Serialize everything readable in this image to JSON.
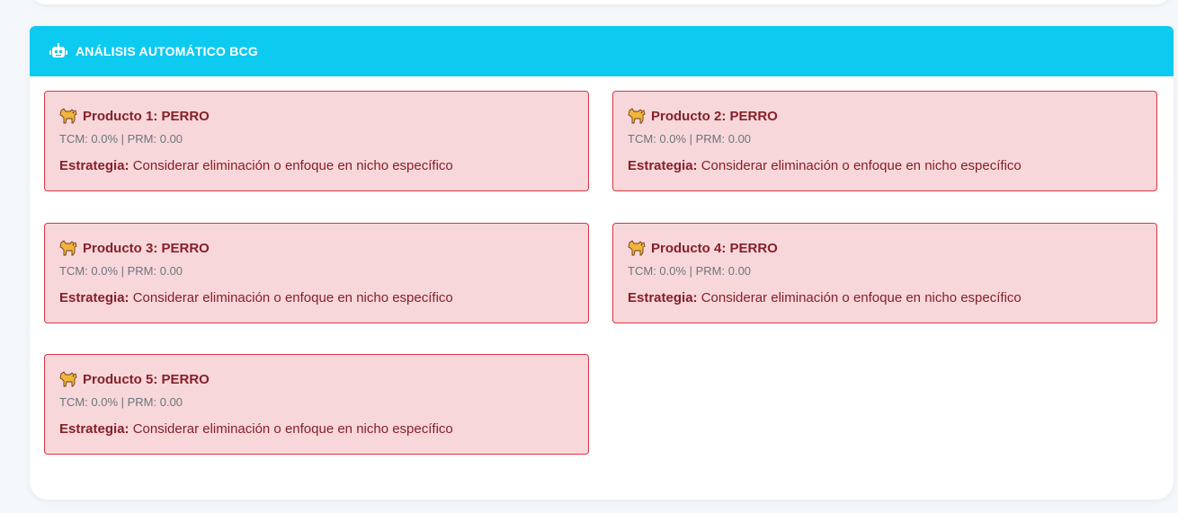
{
  "panel": {
    "title": "ANÁLISIS AUTOMÁTICO BCG",
    "header_color": "#0dcaf0",
    "icon": "robot-icon"
  },
  "products": [
    {
      "title": "Producto 1: PERRO",
      "meta": "TCM: 0.0% | PRM: 0.00",
      "strategy_label": "Estrategia:",
      "strategy_text": " Considerar eliminación o enfoque en nicho específico",
      "icon": "dog-icon"
    },
    {
      "title": "Producto 2: PERRO",
      "meta": "TCM: 0.0% | PRM: 0.00",
      "strategy_label": "Estrategia:",
      "strategy_text": " Considerar eliminación o enfoque en nicho específico",
      "icon": "dog-icon"
    },
    {
      "title": "Producto 3: PERRO",
      "meta": "TCM: 0.0% | PRM: 0.00",
      "strategy_label": "Estrategia:",
      "strategy_text": " Considerar eliminación o enfoque en nicho específico",
      "icon": "dog-icon"
    },
    {
      "title": "Producto 4: PERRO",
      "meta": "TCM: 0.0% | PRM: 0.00",
      "strategy_label": "Estrategia:",
      "strategy_text": " Considerar eliminación o enfoque en nicho específico",
      "icon": "dog-icon"
    },
    {
      "title": "Producto 5: PERRO",
      "meta": "TCM: 0.0% | PRM: 0.00",
      "strategy_label": "Estrategia:",
      "strategy_text": " Considerar eliminación o enfoque en nicho específico",
      "icon": "dog-icon"
    }
  ],
  "colors": {
    "alert_bg": "#f8d7da",
    "alert_border": "#dc3545",
    "alert_text": "#842029",
    "muted_text": "#6c757d"
  }
}
